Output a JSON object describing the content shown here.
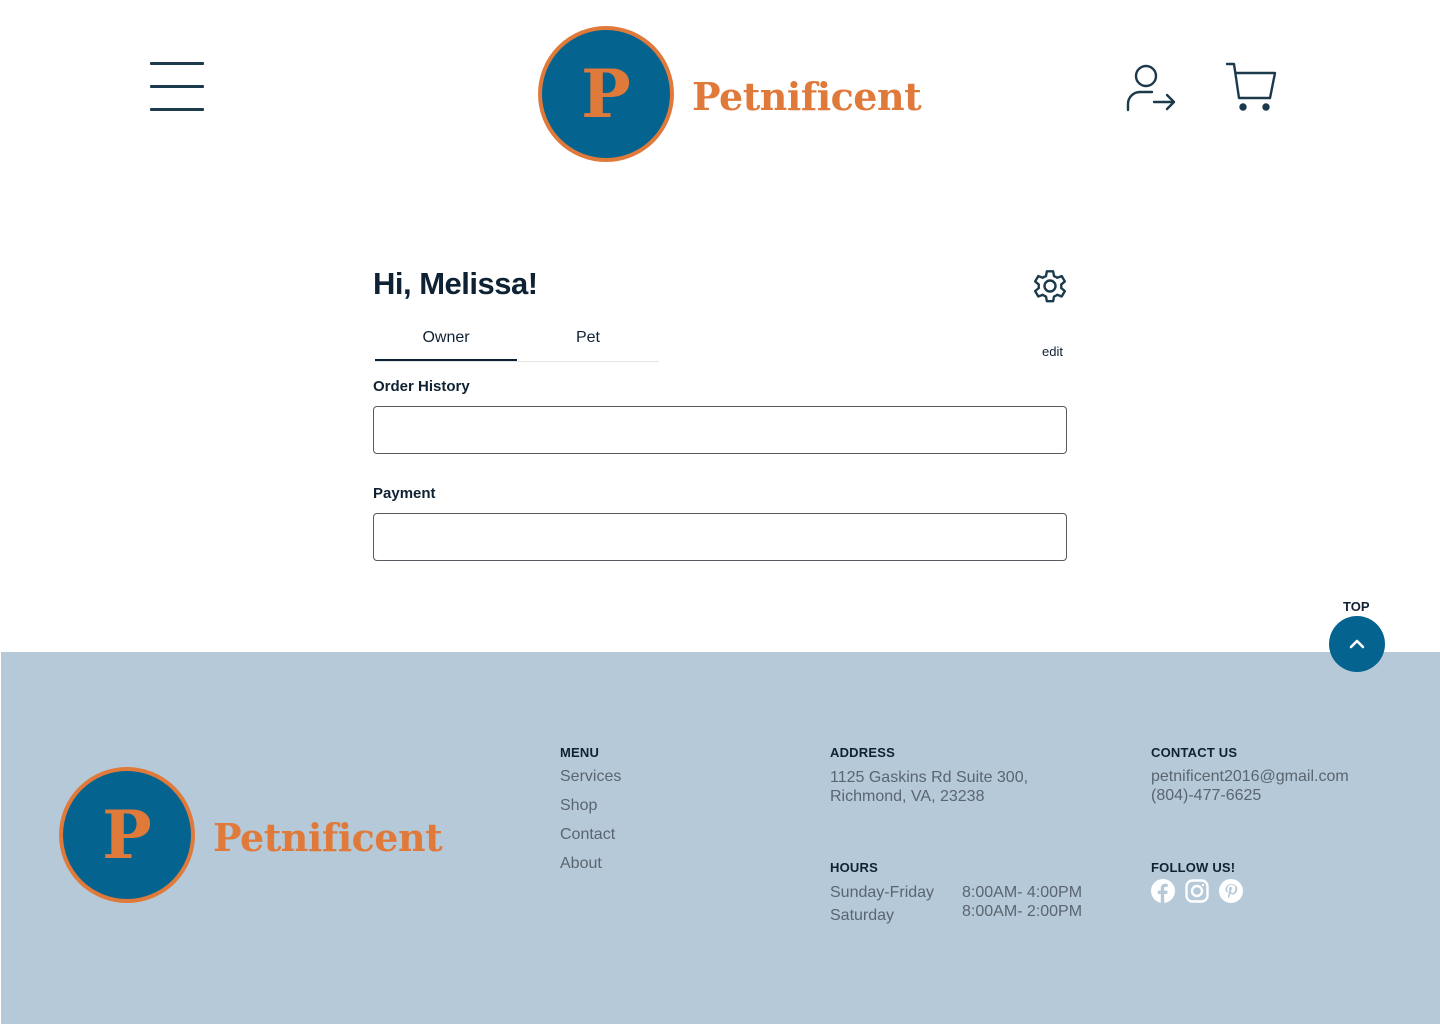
{
  "brand": {
    "logo_letter": "P",
    "logo_text": "Petnificent",
    "colors": {
      "primary": "#05638f",
      "accent": "#e07a3b",
      "footer_bg": "#b6c9d8",
      "text": "#0f2233"
    }
  },
  "header": {
    "icons": [
      "hamburger-menu-icon",
      "login-icon",
      "cart-icon"
    ]
  },
  "account": {
    "greeting": "Hi, Melissa!",
    "edit_label": "edit",
    "tabs": [
      {
        "label": "Owner",
        "active": true
      },
      {
        "label": "Pet",
        "active": false
      }
    ],
    "order_history_label": "Order History",
    "payment_label": "Payment"
  },
  "top_button": {
    "label": "TOP"
  },
  "footer": {
    "menu": {
      "heading": "MENU",
      "items": [
        "Services",
        "Shop",
        "Contact",
        "About"
      ]
    },
    "address": {
      "heading": "ADDRESS",
      "line1": "1125 Gaskins Rd Suite 300,",
      "line2": "Richmond, VA, 23238"
    },
    "hours": {
      "heading": "HOURS",
      "rows": [
        {
          "days": "Sunday-Friday",
          "time": "8:00AM- 4:00PM"
        },
        {
          "days": "Saturday",
          "time": "8:00AM- 2:00PM"
        }
      ]
    },
    "contact": {
      "heading": "CONTACT US",
      "email": "petnificent2016@gmail.com",
      "phone": "(804)-477-6625"
    },
    "follow": {
      "heading": "FOLLOW US!",
      "icons": [
        "facebook-icon",
        "instagram-icon",
        "pinterest-icon"
      ]
    }
  }
}
